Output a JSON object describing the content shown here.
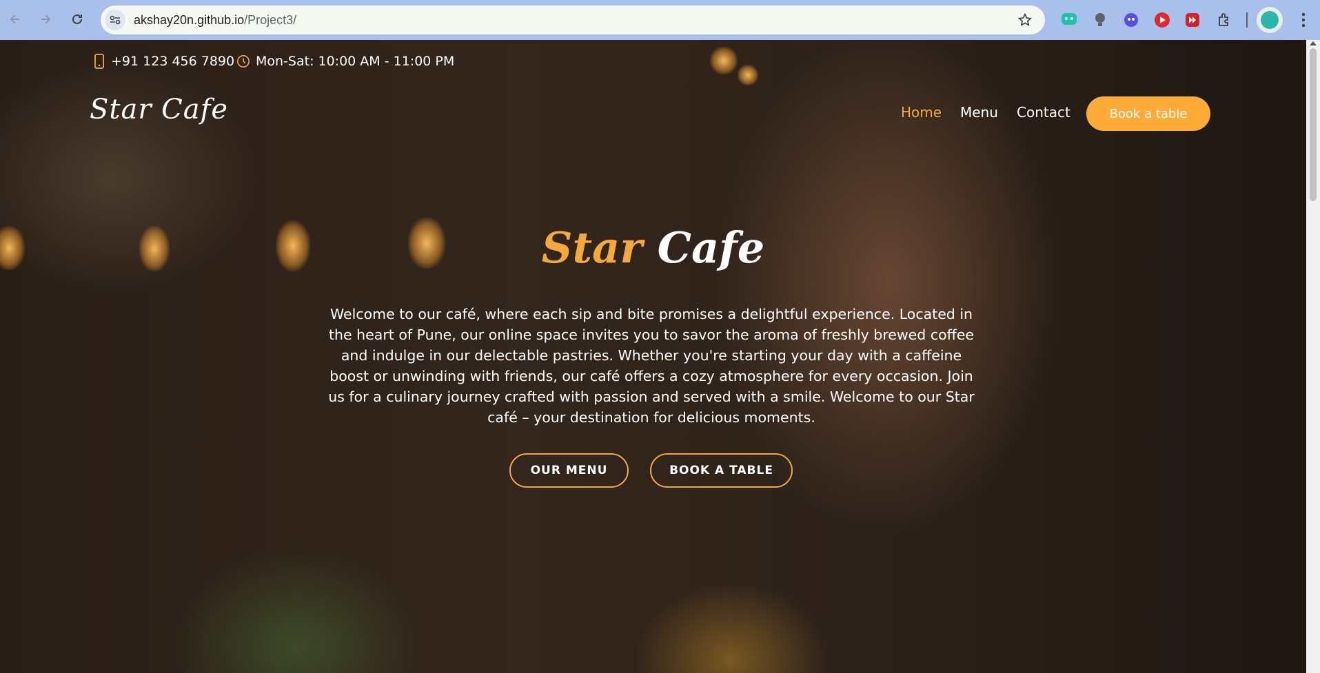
{
  "browser": {
    "url_host": "akshay20n.github.io",
    "url_path": "/Project3/"
  },
  "topbar": {
    "phone": "+91 123 456 7890",
    "hours": "Mon-Sat: 10:00 AM - 11:00 PM"
  },
  "nav": {
    "brand": "Star Cafe",
    "items": [
      {
        "label": "Home",
        "active": true
      },
      {
        "label": "Menu",
        "active": false
      },
      {
        "label": "Contact",
        "active": false
      }
    ],
    "cta": "Book a table"
  },
  "hero": {
    "title_part1": "Star",
    "title_part2": "Cafe",
    "description": "Welcome to our café, where each sip and bite promises a delightful experience. Located in the heart of Pune, our online space invites you to savor the aroma of freshly brewed coffee and indulge in our delectable pastries. Whether you're starting your day with a caffeine boost or unwinding with friends, our café offers a cozy atmosphere for every occasion. Join us for a culinary journey crafted with passion and served with a smile. Welcome to our Star café – your destination for delicious moments.",
    "btn_menu": "OUR MENU",
    "btn_book": "BOOK A TABLE"
  },
  "colors": {
    "accent": "#f5a93a",
    "cta_bg": "#ffab38",
    "chrome_bg": "#a9c0ea"
  }
}
